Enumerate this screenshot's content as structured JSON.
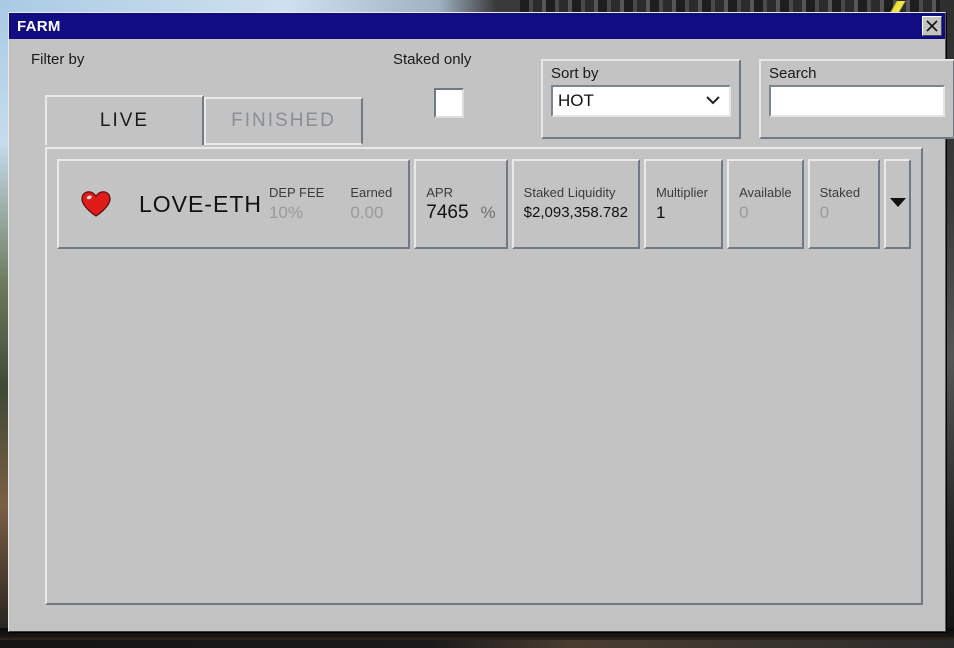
{
  "window": {
    "title": "FARM",
    "close_icon": "close-x-icon"
  },
  "controls": {
    "filter_by_label": "Filter by",
    "staked_only_label": "Staked only",
    "staked_only_checked": false,
    "tabs": [
      {
        "label": "LIVE",
        "active": true
      },
      {
        "label": "FINISHED",
        "active": false
      }
    ],
    "sort_by": {
      "legend": "Sort by",
      "value": "HOT",
      "caret_icon": "chevron-down-icon"
    },
    "search": {
      "legend": "Search",
      "value": "",
      "placeholder": ""
    }
  },
  "list": {
    "expand_icon": "caret-down-icon",
    "rows": [
      {
        "favorite_icon": "heart-icon",
        "pair": "LOVE-ETH",
        "dep_fee_label": "DEP FEE",
        "dep_fee_value": "10%",
        "earned_label": "Earned",
        "earned_value": "0.00",
        "apr_label": "APR",
        "apr_value": "7465",
        "apr_unit": "%",
        "liquidity_label": "Staked Liquidity",
        "liquidity_value": "$2,093,358.782",
        "multiplier_label": "Multiplier",
        "multiplier_value": "1",
        "available_label": "Available",
        "available_value": "0",
        "staked_label": "Staked",
        "staked_value": "0"
      }
    ]
  },
  "colors": {
    "titlebar": "#120c82",
    "window_face": "#c3c3c3",
    "heart": "#e01b1b",
    "active_tab_text": "#1b1b1b",
    "inactive_tab_text": "#8a8f95"
  }
}
